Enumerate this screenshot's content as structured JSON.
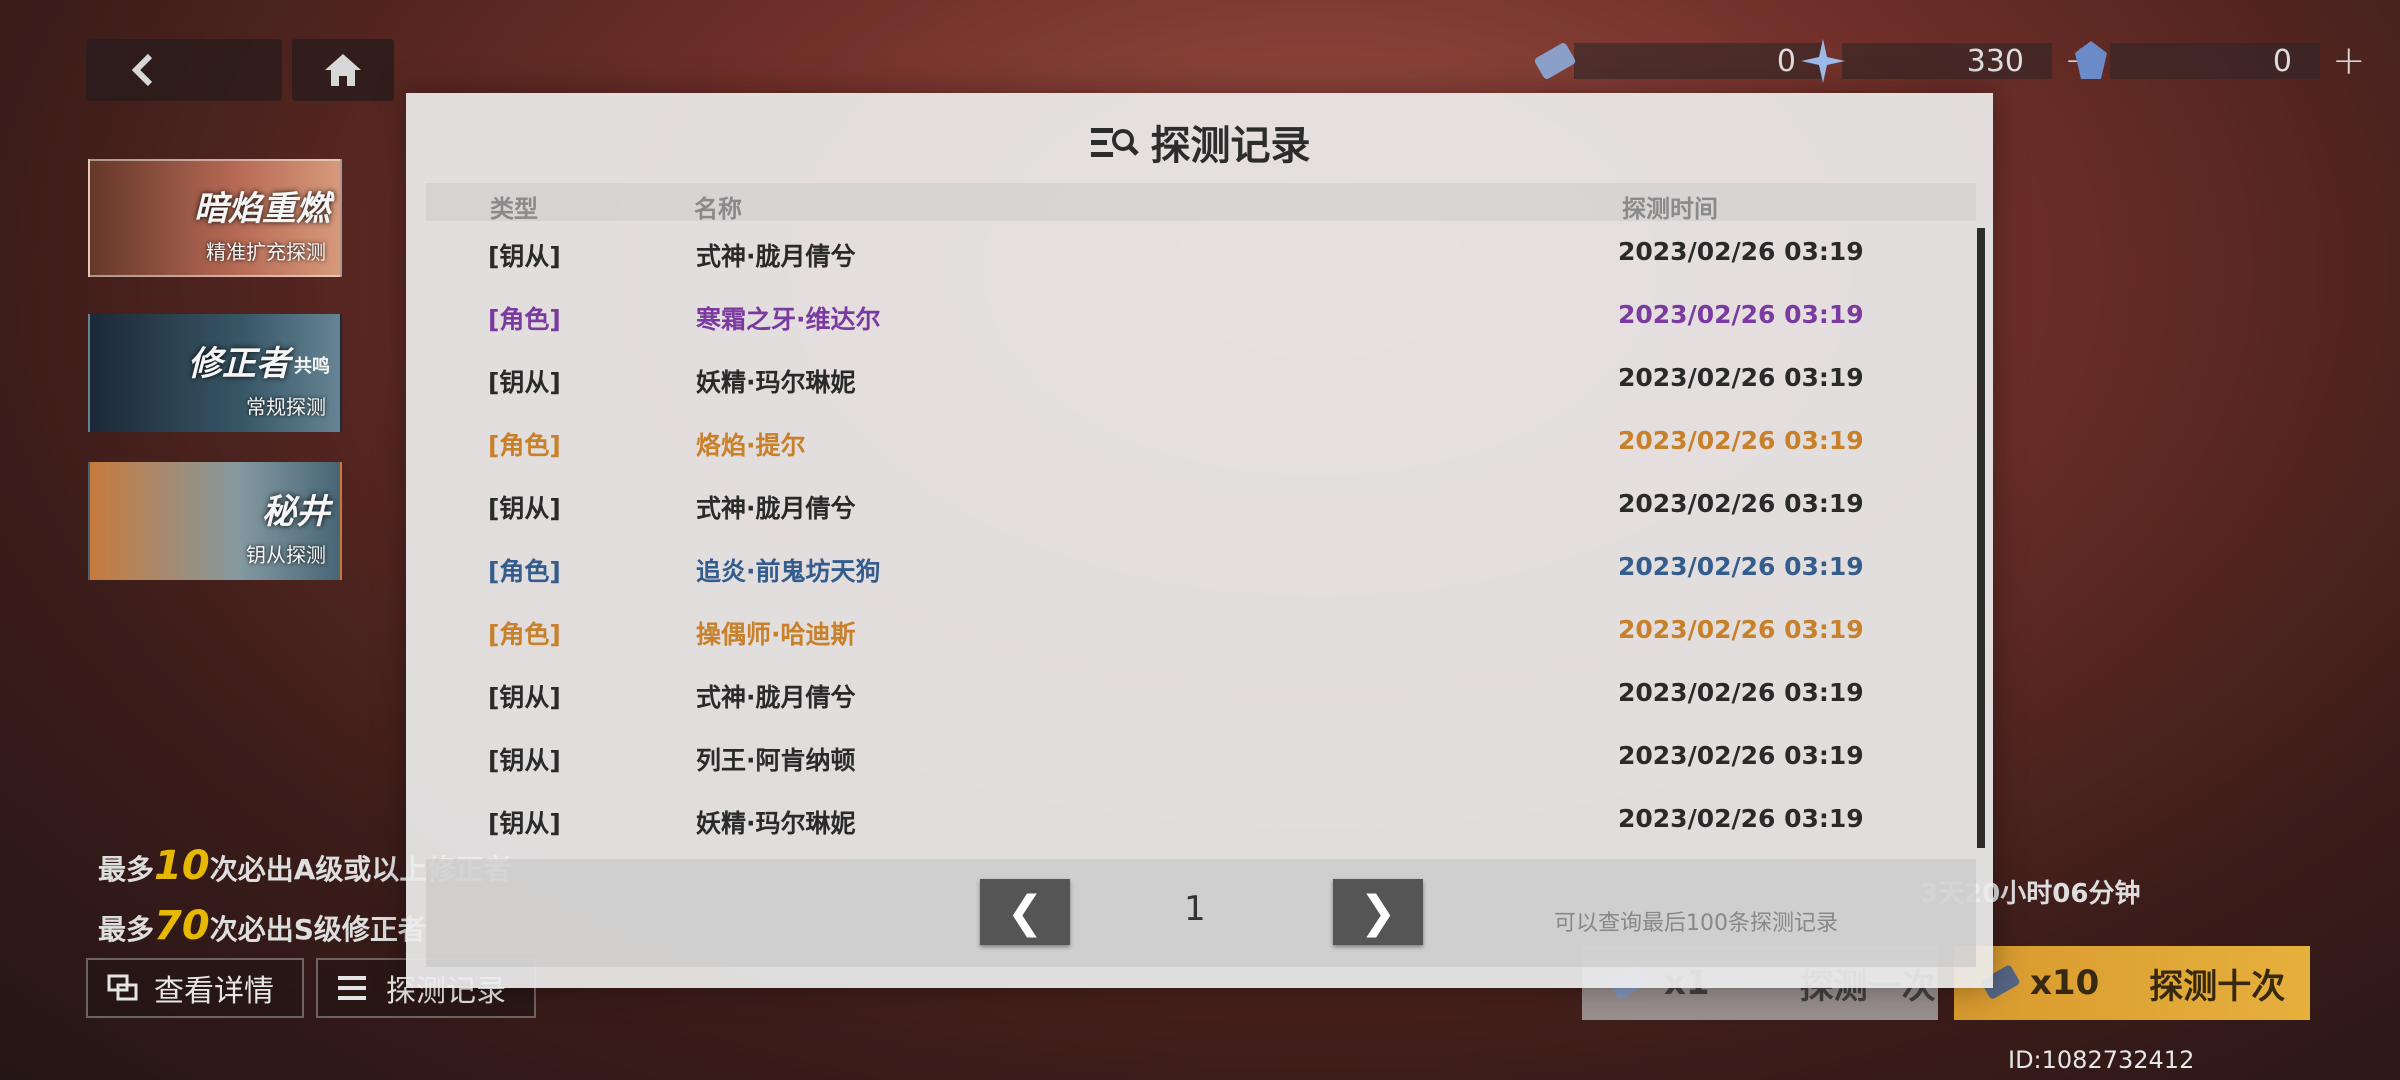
{
  "header": {
    "resources": [
      {
        "icon": "ticket-icon",
        "value": "0",
        "has_plus": false
      },
      {
        "icon": "star-crystal-icon",
        "value": "330",
        "has_plus": true
      },
      {
        "icon": "blue-crystal-icon",
        "value": "0",
        "has_plus": true
      }
    ]
  },
  "banners": [
    {
      "title": "暗焰重燃",
      "subtitle": "精准扩充探测"
    },
    {
      "title": "修正者",
      "title_small": "共鸣",
      "subtitle": "常规探测"
    },
    {
      "title": "秘井",
      "subtitle": "钥从探测"
    }
  ],
  "guarantee": {
    "line1": {
      "prefix": "最多",
      "num": "10",
      "suffix": "次必出A级或以上修正者"
    },
    "line2": {
      "prefix": "最多",
      "num": "70",
      "suffix": "次必出S级修正者"
    }
  },
  "footer": {
    "details_label": "查看详情",
    "records_label": "探测记录",
    "pull1": {
      "count": "x1",
      "label": "探测一次"
    },
    "pull10": {
      "count": "x10",
      "label": "探测十次"
    },
    "countdown": "3天20小时06分钟",
    "uid": "ID:1082732412"
  },
  "modal": {
    "title": "探测记录",
    "headers": {
      "type": "类型",
      "name": "名称",
      "time": "探测时间"
    },
    "rows": [
      {
        "type": "[钥从]",
        "name": "式神·胧月倩兮",
        "time": "2023/02/26 03:19",
        "color": "#2a2a2a"
      },
      {
        "type": "[角色]",
        "name": "寒霜之牙·维达尔",
        "time": "2023/02/26 03:19",
        "color": "#7a3aa0"
      },
      {
        "type": "[钥从]",
        "name": "妖精·玛尔琳妮",
        "time": "2023/02/26 03:19",
        "color": "#2a2a2a"
      },
      {
        "type": "[角色]",
        "name": "烙焰·提尔",
        "time": "2023/02/26 03:19",
        "color": "#c8802a"
      },
      {
        "type": "[钥从]",
        "name": "式神·胧月倩兮",
        "time": "2023/02/26 03:19",
        "color": "#2a2a2a"
      },
      {
        "type": "[角色]",
        "name": "追炎·前鬼坊天狗",
        "time": "2023/02/26 03:19",
        "color": "#345c8c"
      },
      {
        "type": "[角色]",
        "name": "操偶师·哈迪斯",
        "time": "2023/02/26 03:19",
        "color": "#c8802a"
      },
      {
        "type": "[钥从]",
        "name": "式神·胧月倩兮",
        "time": "2023/02/26 03:19",
        "color": "#2a2a2a"
      },
      {
        "type": "[钥从]",
        "name": "列王·阿肯纳顿",
        "time": "2023/02/26 03:19",
        "color": "#2a2a2a"
      },
      {
        "type": "[钥从]",
        "name": "妖精·玛尔琳妮",
        "time": "2023/02/26 03:19",
        "color": "#2a2a2a"
      }
    ],
    "pager": {
      "prev": "❮",
      "page": "1",
      "next": "❯",
      "note": "可以查询最后100条探测记录"
    }
  }
}
